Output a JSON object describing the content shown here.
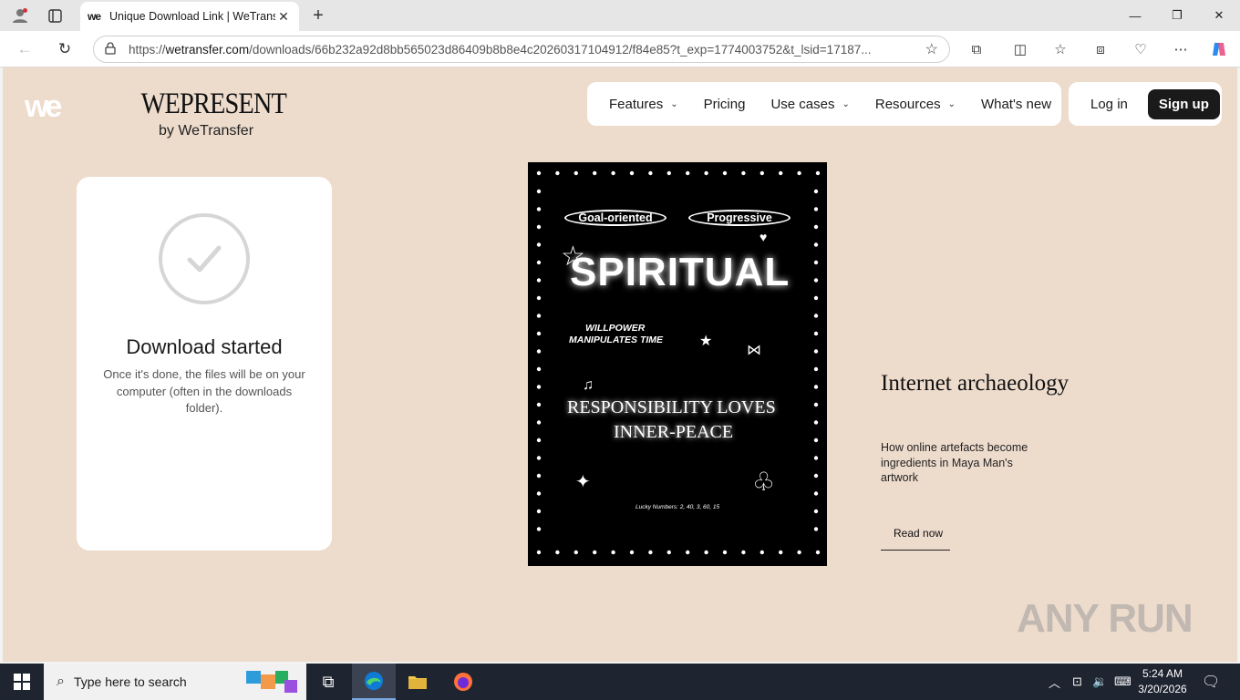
{
  "browser": {
    "tab_title": "Unique Download Link | WeTransfer",
    "tab_favicon": "we",
    "url_scheme": "https://",
    "url_host": "wetransfer.com",
    "url_path": "/downloads/66b232a92d8bb565023d86409b8b8e4c20260317104912/f84e85?t_exp=1774003752&t_lsid=17187..."
  },
  "header": {
    "logo": "we",
    "wepresent_title": "WEPRESENT",
    "wepresent_sub": "by WeTransfer",
    "nav": [
      {
        "label": "Features",
        "dropdown": true
      },
      {
        "label": "Pricing",
        "dropdown": false
      },
      {
        "label": "Use cases",
        "dropdown": true
      },
      {
        "label": "Resources",
        "dropdown": true
      },
      {
        "label": "What's new",
        "dropdown": false
      }
    ],
    "login": "Log in",
    "signup": "Sign up"
  },
  "download_card": {
    "title": "Download started",
    "text": "Once it's done, the files will be on your computer (often in the downloads folder)."
  },
  "artwork": {
    "tag_left": "Goal-oriented",
    "tag_right": "Progressive",
    "headline": "SPIRITUAL",
    "line1": "WILLPOWER",
    "line2": "MANIPULATES TIME",
    "line3": "RESPONSIBILITY LOVES",
    "line4": "INNER-PEACE",
    "lucky": "Lucky Numbers: 2, 40, 3, 60, 15"
  },
  "article": {
    "title": "Internet archaeology",
    "description": "How online artefacts become ingredients in Maya Man's artwork",
    "cta": "Read now"
  },
  "watermark": "ANY RUN",
  "taskbar": {
    "search_placeholder": "Type here to search",
    "time": "5:24 AM",
    "date": "3/20/2026"
  }
}
